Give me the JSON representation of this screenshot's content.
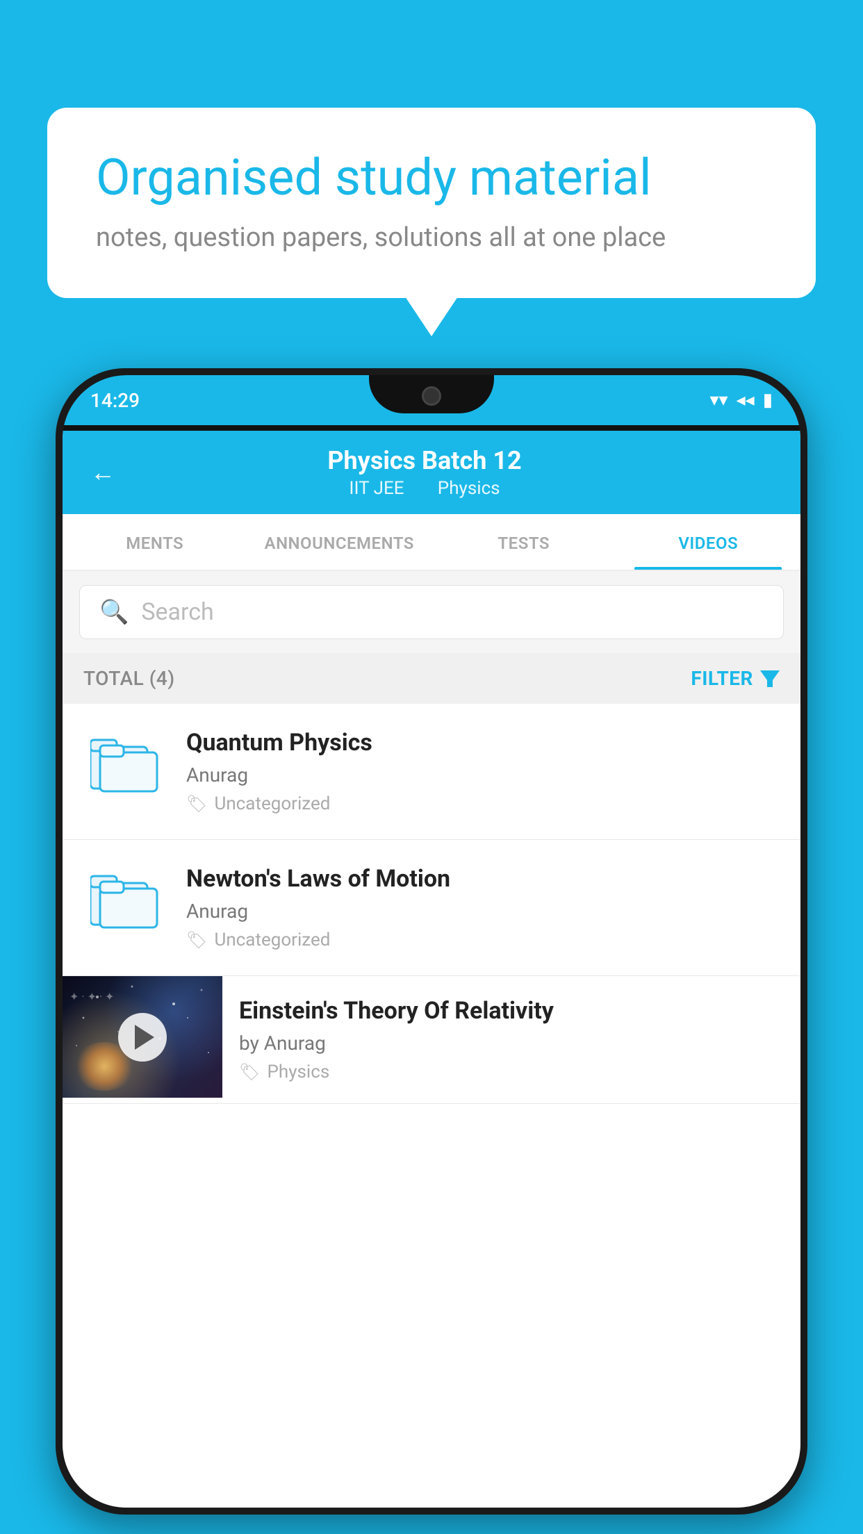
{
  "background_color": "#1ab8e8",
  "speech_bubble": {
    "title": "Organised study material",
    "subtitle": "notes, question papers, solutions all at one place"
  },
  "status_bar": {
    "time": "14:29",
    "wifi_icon": "▼",
    "signal_icon": "▲",
    "battery_icon": "▮"
  },
  "header": {
    "back_label": "←",
    "title": "Physics Batch 12",
    "tag1": "IIT JEE",
    "tag2": "Physics"
  },
  "tabs": [
    {
      "label": "MENTS",
      "active": false
    },
    {
      "label": "ANNOUNCEMENTS",
      "active": false
    },
    {
      "label": "TESTS",
      "active": false
    },
    {
      "label": "VIDEOS",
      "active": true
    }
  ],
  "search": {
    "placeholder": "Search"
  },
  "filter_bar": {
    "total_label": "TOTAL (4)",
    "filter_label": "FILTER"
  },
  "videos": [
    {
      "title": "Quantum Physics",
      "author": "Anurag",
      "tag": "Uncategorized",
      "has_thumbnail": false
    },
    {
      "title": "Newton's Laws of Motion",
      "author": "Anurag",
      "tag": "Uncategorized",
      "has_thumbnail": false
    },
    {
      "title": "Einstein's Theory Of Relativity",
      "author": "by Anurag",
      "tag": "Physics",
      "has_thumbnail": true
    }
  ]
}
